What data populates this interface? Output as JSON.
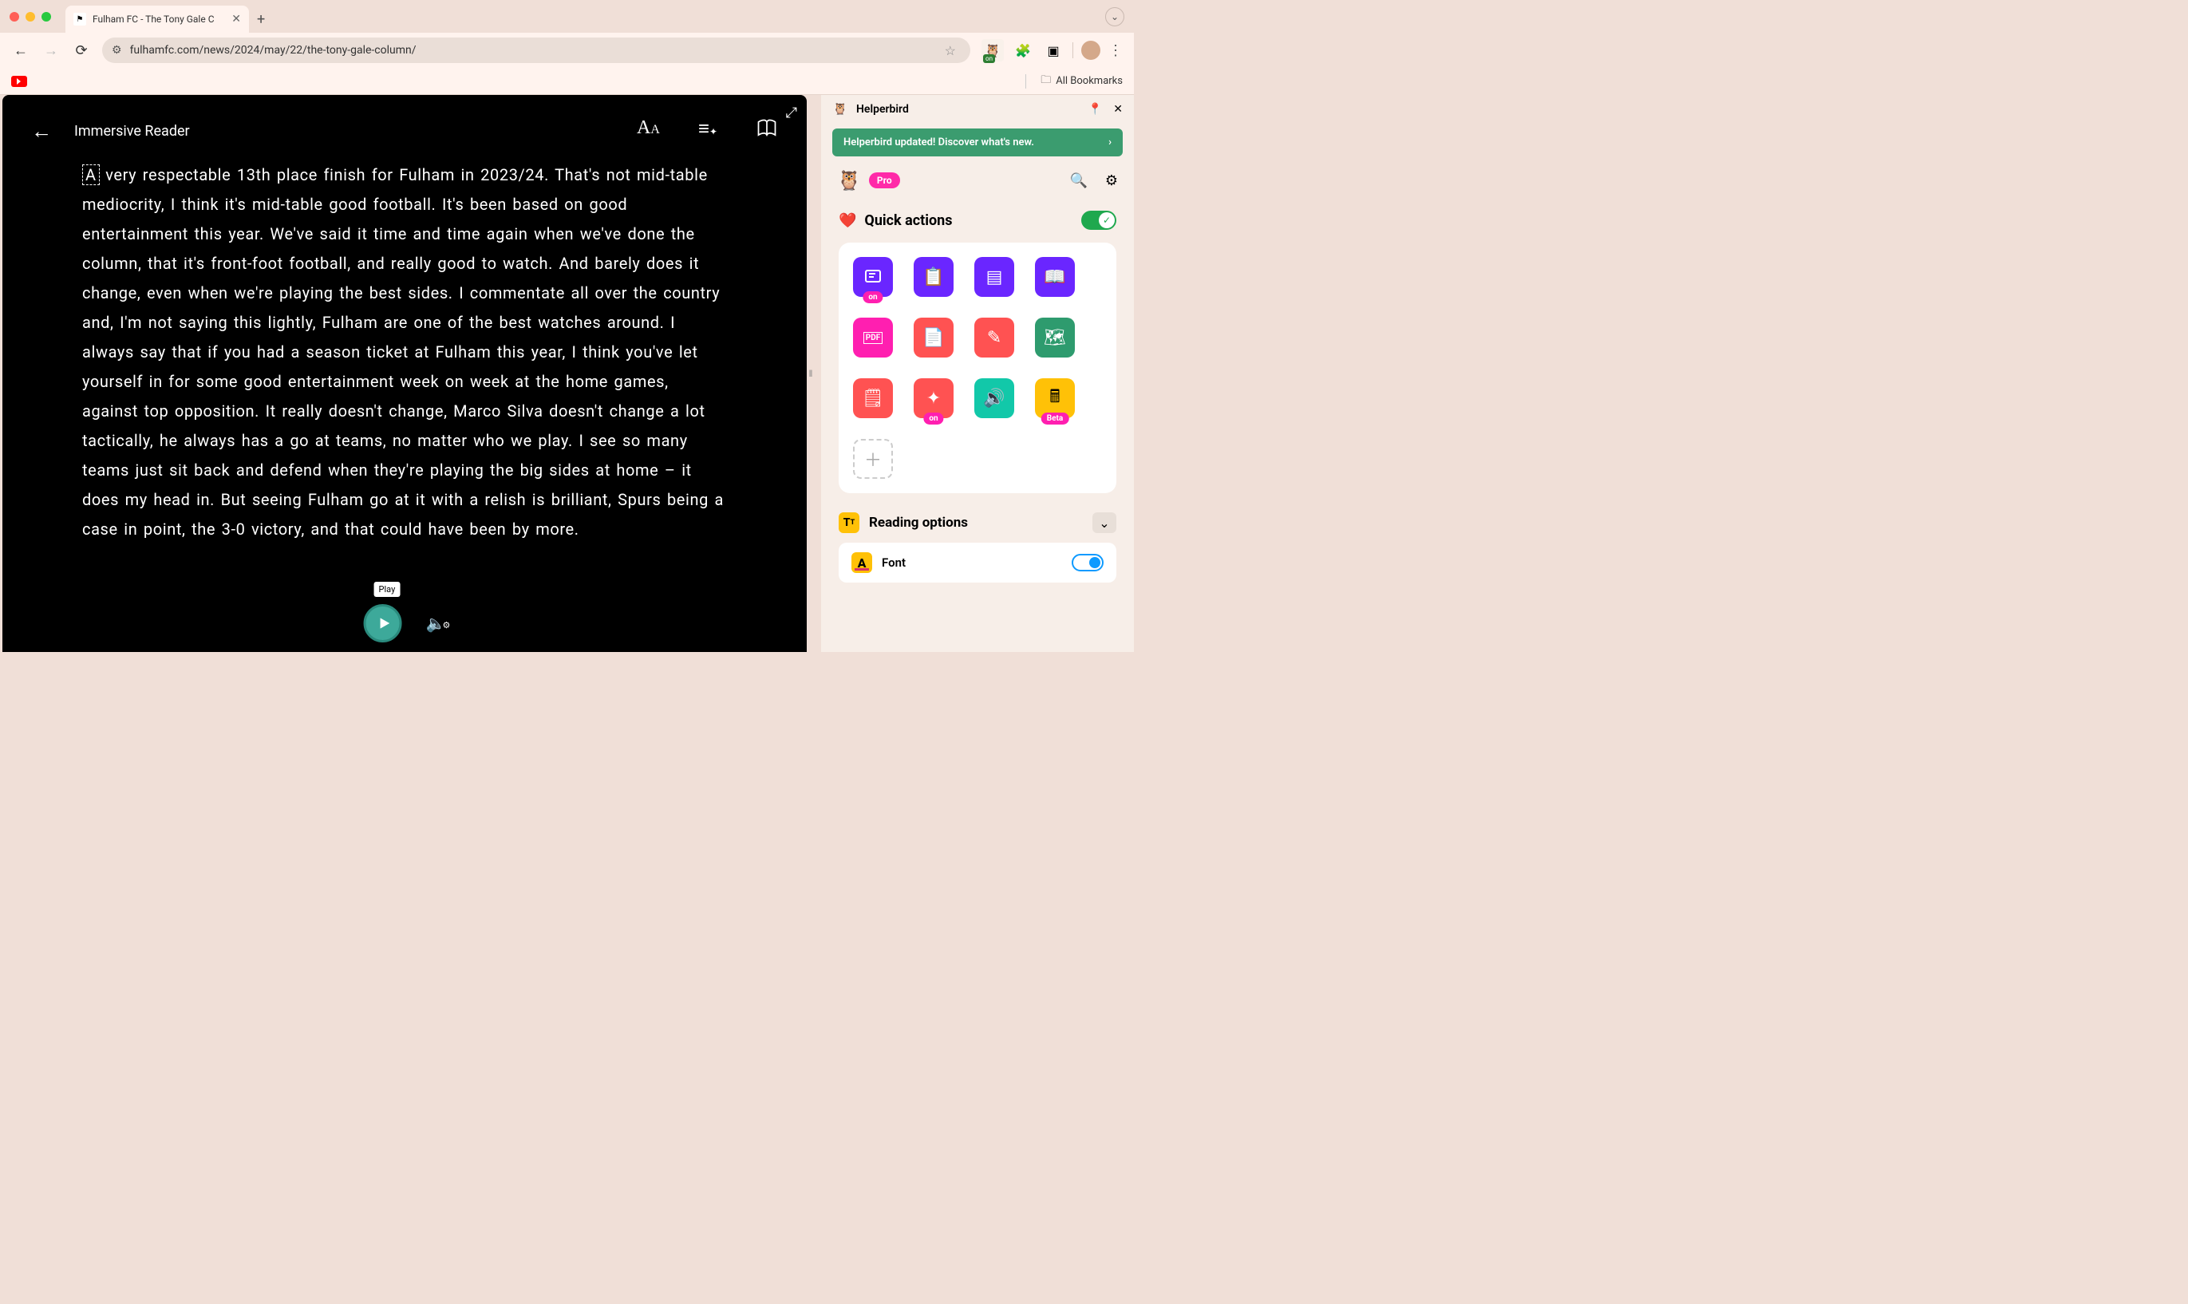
{
  "browser": {
    "tab_title": "Fulham FC - The Tony Gale C",
    "url": "fulhamfc.com/news/2024/may/22/the-tony-gale-column/",
    "ext_badge": "on",
    "bookmarks_label": "All Bookmarks"
  },
  "reader": {
    "title": "Immersive Reader",
    "body": "A very respectable 13th place finish for Fulham in 2023/24. That's not mid-table mediocrity, I think it's mid-table good football. It's been based on good entertainment this year. We've said it time and time again when we've done the column, that it's front-foot football, and really good to watch. And barely does it change, even when we're playing the best sides. I commentate all over the country and, I'm not saying this lightly, Fulham are one of the best watches around. I always say that if you had a season ticket at Fulham this year, I think you've let yourself in for some good entertainment week on week at the home games, against top opposition. It really doesn't change, Marco Silva doesn't change a lot tactically, he always has a go at teams, no matter who we play. I see so many teams just sit back and defend when they're playing the big sides at home – it does my head in. But seeing Fulham go at it with a relish is brilliant, Spurs being a case in point, the 3-0 victory, and that could have been by more.",
    "play_tooltip": "Play"
  },
  "helperbird": {
    "title": "Helperbird",
    "banner": "Helperbird updated! Discover what's new.",
    "pro": "Pro",
    "quick_actions_label": "Quick actions",
    "qa_badges": {
      "on": "on",
      "beta": "Beta"
    },
    "reading_options_label": "Reading options",
    "font_label": "Font"
  }
}
